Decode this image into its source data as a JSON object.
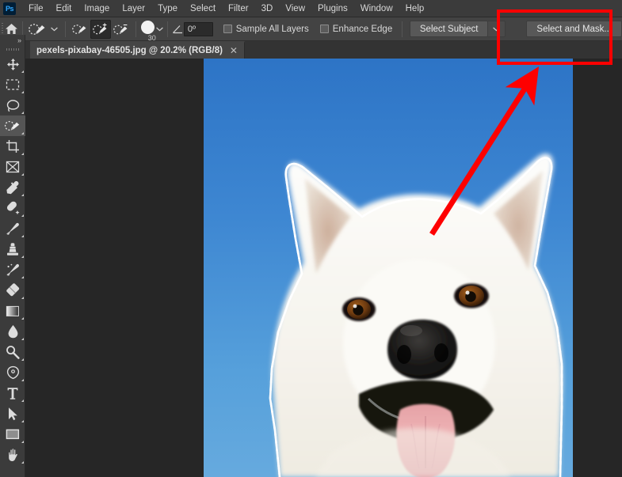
{
  "app": {
    "name": "Adobe Photoshop",
    "logo_text": "Ps"
  },
  "menubar": {
    "items": [
      {
        "label": "File"
      },
      {
        "label": "Edit"
      },
      {
        "label": "Image"
      },
      {
        "label": "Layer"
      },
      {
        "label": "Type"
      },
      {
        "label": "Select"
      },
      {
        "label": "Filter"
      },
      {
        "label": "3D"
      },
      {
        "label": "View"
      },
      {
        "label": "Plugins"
      },
      {
        "label": "Window"
      },
      {
        "label": "Help"
      }
    ]
  },
  "options_bar": {
    "home_icon": "home-icon",
    "tool_preset_icon": "quick-selection-brush-icon",
    "tool_preset_chevron": "chevron-down-icon",
    "selection_modes": [
      {
        "name": "new-selection",
        "icon": "quick-selection-new-icon",
        "active": false
      },
      {
        "name": "add-to-selection",
        "icon": "quick-selection-add-icon",
        "active": true
      },
      {
        "name": "subtract-from-selection",
        "icon": "quick-selection-subtract-icon",
        "active": false
      }
    ],
    "brush_size": "30",
    "brush_chevron": "chevron-down-icon",
    "angle_icon": "angle-icon",
    "angle_value": "0º",
    "sample_all_layers": {
      "label": "Sample All Layers",
      "checked": false
    },
    "enhance_edge": {
      "label": "Enhance Edge",
      "checked": false
    },
    "select_subject_label": "Select Subject",
    "select_subject_chevron": "chevron-down-icon",
    "select_and_mask_label": "Select and Mask..."
  },
  "document_tab": {
    "title": "pexels-pixabay-46505.jpg @ 20.2% (RGB/8)",
    "close_icon": "close-icon"
  },
  "toolbar": {
    "expand_icon": "double-chevron-right-icon",
    "grip_icon": "drag-handle-icon",
    "tools": [
      {
        "name": "move-tool",
        "icon": "move-icon",
        "active": false
      },
      {
        "name": "rectangular-marquee-tool",
        "icon": "marquee-icon",
        "active": false
      },
      {
        "name": "lasso-tool",
        "icon": "lasso-icon",
        "active": false
      },
      {
        "name": "quick-selection-tool",
        "icon": "quick-selection-icon",
        "active": true
      },
      {
        "name": "crop-tool",
        "icon": "crop-icon",
        "active": false
      },
      {
        "name": "frame-tool",
        "icon": "frame-icon",
        "active": false
      },
      {
        "name": "eyedropper-tool",
        "icon": "eyedropper-icon",
        "active": false
      },
      {
        "name": "spot-healing-brush-tool",
        "icon": "healing-brush-icon",
        "active": false
      },
      {
        "name": "brush-tool",
        "icon": "brush-icon",
        "active": false
      },
      {
        "name": "clone-stamp-tool",
        "icon": "clone-stamp-icon",
        "active": false
      },
      {
        "name": "history-brush-tool",
        "icon": "history-brush-icon",
        "active": false
      },
      {
        "name": "eraser-tool",
        "icon": "eraser-icon",
        "active": false
      },
      {
        "name": "gradient-tool",
        "icon": "gradient-icon",
        "active": false
      },
      {
        "name": "blur-tool",
        "icon": "blur-droplet-icon",
        "active": false
      },
      {
        "name": "dodge-tool",
        "icon": "dodge-icon",
        "active": false
      },
      {
        "name": "pen-tool",
        "icon": "pen-icon",
        "active": false
      },
      {
        "name": "type-tool",
        "icon": "type-icon",
        "active": false
      },
      {
        "name": "path-selection-tool",
        "icon": "path-arrow-icon",
        "active": false
      },
      {
        "name": "rectangle-shape-tool",
        "icon": "rectangle-icon",
        "active": false
      },
      {
        "name": "hand-tool",
        "icon": "hand-icon",
        "active": false
      }
    ]
  },
  "canvas": {
    "image_description": "White Swiss Shepherd dog facing camera with open mouth and pink tongue against a blue sky",
    "selection_active": true,
    "selection_style": "marching-ants",
    "sky_color_top": "#2d74c6",
    "sky_color_bottom": "#66aade"
  },
  "annotations": {
    "highlight_color": "#fe0000",
    "rectangle_target": "select-and-mask-button",
    "arrow_from": "dog-right-eye",
    "arrow_to": "select-and-mask-button"
  }
}
